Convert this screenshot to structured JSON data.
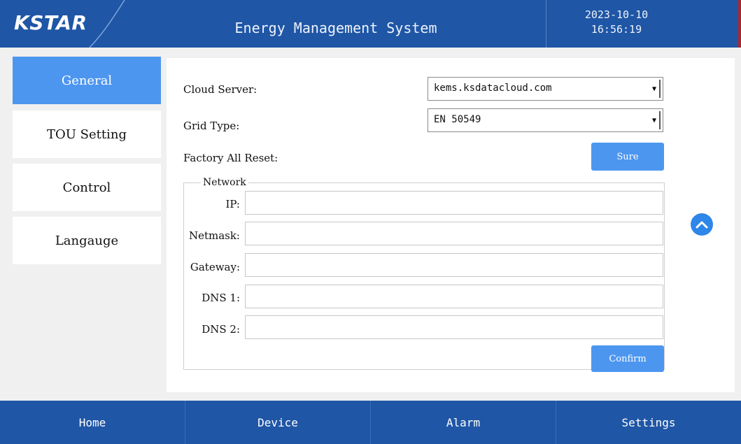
{
  "header": {
    "logo": "KSTAR",
    "title": "Energy Management System",
    "date": "2023-10-10",
    "time": "16:56:19"
  },
  "sidebar": {
    "items": [
      {
        "label": "General",
        "active": true
      },
      {
        "label": "TOU Setting",
        "active": false
      },
      {
        "label": "Control",
        "active": false
      },
      {
        "label": "Langauge",
        "active": false
      }
    ]
  },
  "general": {
    "cloud_server_label": "Cloud Server:",
    "cloud_server_value": "kems.ksdatacloud.com",
    "grid_type_label": "Grid Type:",
    "grid_type_value": "EN 50549",
    "factory_reset_label": "Factory All Reset:",
    "sure_label": "Sure",
    "network": {
      "legend": "Network",
      "ip_label": "IP:",
      "ip_value": "",
      "netmask_label": "Netmask:",
      "netmask_value": "",
      "gateway_label": "Gateway:",
      "gateway_value": "",
      "dns1_label": "DNS 1:",
      "dns1_value": "",
      "dns2_label": "DNS 2:",
      "dns2_value": "",
      "confirm_label": "Confirm"
    }
  },
  "footer": {
    "items": [
      "Home",
      "Device",
      "Alarm",
      "Settings"
    ]
  },
  "colors": {
    "header_bg": "#1f56a6",
    "accent": "#4d96f0",
    "panel_bg": "#ffffff",
    "page_bg": "#f0f0f0"
  },
  "icons": {
    "scroll_up": "chevron-up-circle-icon",
    "dropdown": "triangle-down-icon"
  }
}
